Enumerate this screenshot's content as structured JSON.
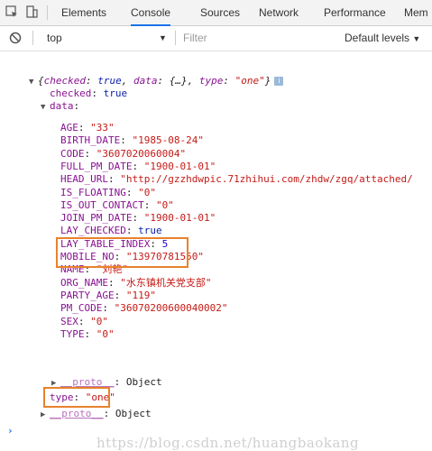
{
  "tabs": [
    "Elements",
    "Console",
    "Sources",
    "Network",
    "Performance",
    "Mem"
  ],
  "active_tab": "Console",
  "filter_bar": {
    "context": "top",
    "filter_placeholder": "Filter",
    "levels": "Default levels"
  },
  "console": {
    "summary": {
      "open": "{",
      "k1": "checked",
      "v1": "true",
      "k2": "data",
      "v2": "{…}",
      "k3": "type",
      "v3": "\"one\"",
      "close": "}",
      "info": "i"
    },
    "checked": {
      "key": "checked",
      "value": "true"
    },
    "data_key": "data",
    "fields": [
      {
        "key": "AGE",
        "value": "\"33\""
      },
      {
        "key": "BIRTH_DATE",
        "value": "\"1985-08-24\""
      },
      {
        "key": "CODE",
        "value": "\"3607020060004\""
      },
      {
        "key": "FULL_PM_DATE",
        "value": "\"1900-01-01\""
      },
      {
        "key": "HEAD_URL",
        "value": "\"http://gzzhdwpic.71zhihui.com/zhdw/zgq/attached/"
      },
      {
        "key": "IS_FLOATING",
        "value": "\"0\""
      },
      {
        "key": "IS_OUT_CONTACT",
        "value": "\"0\""
      },
      {
        "key": "JOIN_PM_DATE",
        "value": "\"1900-01-01\""
      },
      {
        "key": "LAY_CHECKED",
        "value": "true"
      },
      {
        "key": "LAY_TABLE_INDEX",
        "value": "5"
      },
      {
        "key": "MOBILE_NO",
        "value": "\"13970781550\""
      },
      {
        "key": "NAME",
        "value": "\"刘艳\""
      },
      {
        "key": "ORG_NAME",
        "value": "\"水东镇机关党支部\""
      },
      {
        "key": "PARTY_AGE",
        "value": "\"119\""
      },
      {
        "key": "PM_CODE",
        "value": "\"36070200600040002\""
      },
      {
        "key": "SEX",
        "value": "\"0\""
      },
      {
        "key": "TYPE",
        "value": "\"0\""
      }
    ],
    "data_proto": {
      "key": "__proto__",
      "value": "Object"
    },
    "type": {
      "key": "type",
      "value": "\"one\""
    },
    "proto": {
      "key": "__proto__",
      "value": "Object"
    },
    "prompt": "›"
  },
  "watermark": "https://blog.csdn.net/huangbaokang"
}
